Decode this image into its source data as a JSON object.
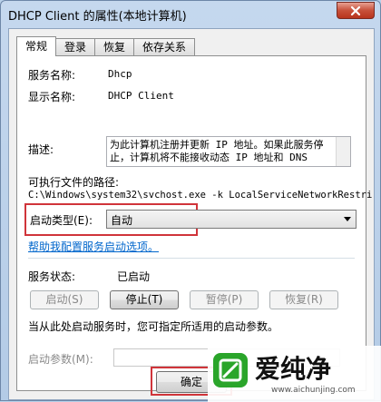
{
  "window": {
    "title": "DHCP Client 的属性(本地计算机)"
  },
  "tabs": [
    {
      "label": "常规",
      "active": true
    },
    {
      "label": "登录",
      "active": false
    },
    {
      "label": "恢复",
      "active": false
    },
    {
      "label": "依存关系",
      "active": false
    }
  ],
  "general": {
    "service_name_label": "服务名称:",
    "service_name_value": "Dhcp",
    "display_name_label": "显示名称:",
    "display_name_value": "DHCP Client",
    "description_label": "描述:",
    "description_value": "为此计算机注册并更新 IP 地址。如果此服务停止，计算机将不能接收动态 IP 地址和 DNS",
    "exe_path_label": "可执行文件的路径:",
    "exe_path_value": "C:\\Windows\\system32\\svchost.exe -k LocalServiceNetworkRestri",
    "startup_type_label": "启动类型(E):",
    "startup_type_value": "自动",
    "help_link": "帮助我配置服务启动选项。",
    "status_label": "服务状态:",
    "status_value": "已启动",
    "note": "当从此处启动服务时，您可指定所适用的启动参数。",
    "start_params_label": "启动参数(M):",
    "start_params_value": ""
  },
  "buttons": {
    "start": "启动(S)",
    "stop": "停止(T)",
    "pause": "暂停(P)",
    "resume": "恢复(R)",
    "ok": "确定"
  },
  "watermark": {
    "text": "爱纯净",
    "url": "www.aichunjing.com"
  },
  "colors": {
    "highlight_box": "#d0343a",
    "link": "#0066cc"
  }
}
